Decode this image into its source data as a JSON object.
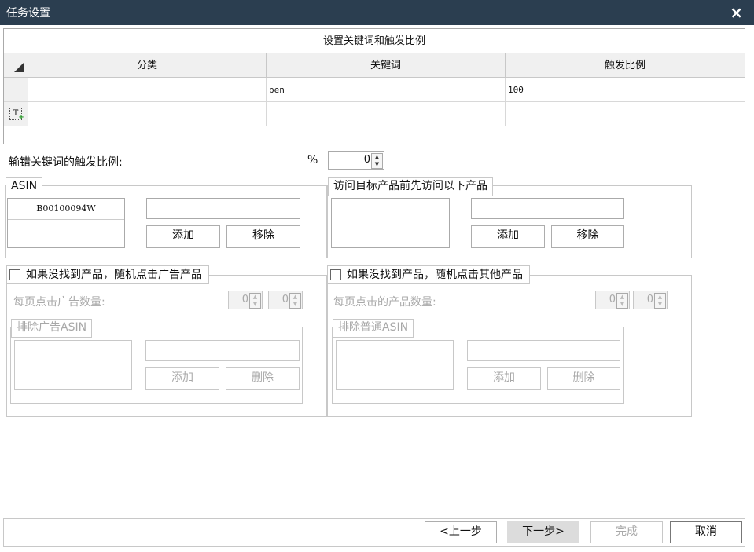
{
  "window": {
    "title": "任务设置",
    "close_glyph": "×"
  },
  "keyword_grid": {
    "caption": "设置关键词和触发比例",
    "columns": [
      "分类",
      "关键词",
      "触发比例"
    ],
    "rows": [
      {
        "category": "",
        "keyword": "pen",
        "ratio": "100"
      }
    ],
    "new_row_icon": "T"
  },
  "misspell": {
    "label": "输错关键词的触发比例:",
    "unit": "%",
    "value": "0"
  },
  "asin_group": {
    "legend": "ASIN",
    "items": [
      "B00100094W"
    ],
    "input_value": "",
    "add_label": "添加",
    "remove_label": "移除"
  },
  "visit_group": {
    "legend": "访问目标产品前先访问以下产品",
    "input_value": "",
    "add_label": "添加",
    "remove_label": "移除"
  },
  "ad_group": {
    "checkbox_label": "如果没找到产品，随机点击广告产品",
    "count_label": "每页点击广告数量:",
    "spin1": "0",
    "spin2": "0",
    "exclude": {
      "legend": "排除广告ASIN",
      "input_value": "",
      "add_label": "添加",
      "delete_label": "删除"
    }
  },
  "other_group": {
    "checkbox_label": "如果没找到产品，随机点击其他产品",
    "count_label": "每页点击的产品数量:",
    "spin1": "0",
    "spin2": "0",
    "exclude": {
      "legend": "排除普通ASIN",
      "input_value": "",
      "add_label": "添加",
      "delete_label": "删除"
    }
  },
  "footer": {
    "prev_label": "<上一步",
    "next_label": "下一步>",
    "finish_label": "完成",
    "cancel_label": "取消"
  },
  "colors": {
    "titlebar": "#2b3e50",
    "disabled_text": "#a8a8a8",
    "next_button_bg": "#dcdcdc"
  }
}
